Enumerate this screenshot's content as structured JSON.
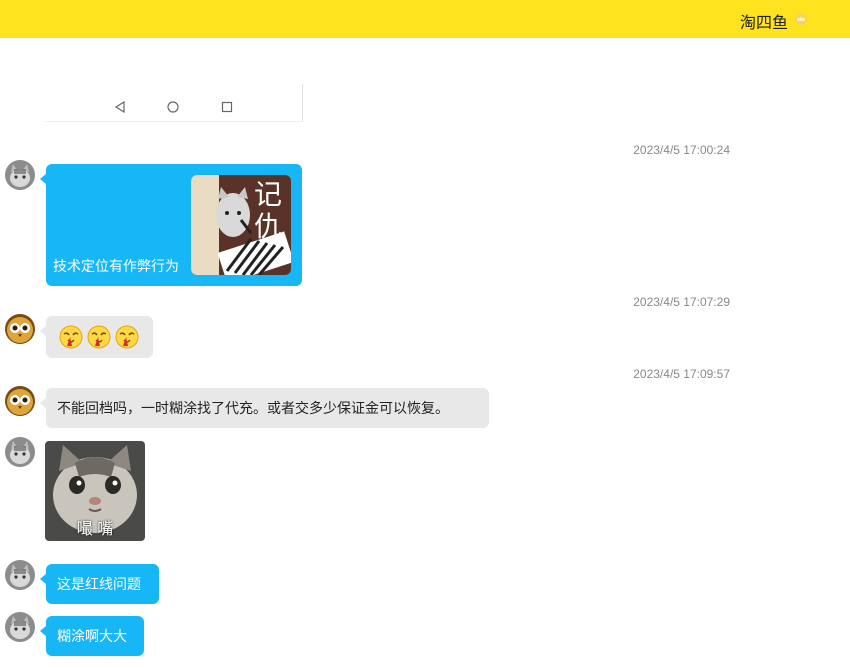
{
  "header": {
    "username": "淘四鱼",
    "accent": "#ffe31f",
    "badge_icon": "crown-badge-icon"
  },
  "colors": {
    "self_bubble": "#17b6f5",
    "other_bubble": "#e8e8e8"
  },
  "phone_nav": [
    "back-triangle-icon",
    "home-circle-icon",
    "recents-square-icon"
  ],
  "messages": [
    {
      "timestamp": "2023/4/5 17:00:24",
      "sender": "cat",
      "type": "image-text",
      "text": "技术定位有作弊行为",
      "sticker_text": "记仇"
    },
    {
      "timestamp": "2023/4/5 17:07:29",
      "sender": "owl",
      "type": "emoji",
      "emoji": [
        "blood-nose-emoji",
        "blood-nose-emoji",
        "blood-nose-emoji"
      ]
    },
    {
      "timestamp": "2023/4/5 17:09:57",
      "sender": "owl",
      "type": "text",
      "text": "不能回档吗，一时糊涂找了代充。或者交多少保证金可以恢复。"
    },
    {
      "sender": "cat",
      "type": "sticker",
      "sticker_text": "嘬 嘴"
    },
    {
      "sender": "cat",
      "type": "text",
      "text": "这是红线问题"
    },
    {
      "sender": "cat",
      "type": "text",
      "text": "糊涂啊大大"
    }
  ]
}
